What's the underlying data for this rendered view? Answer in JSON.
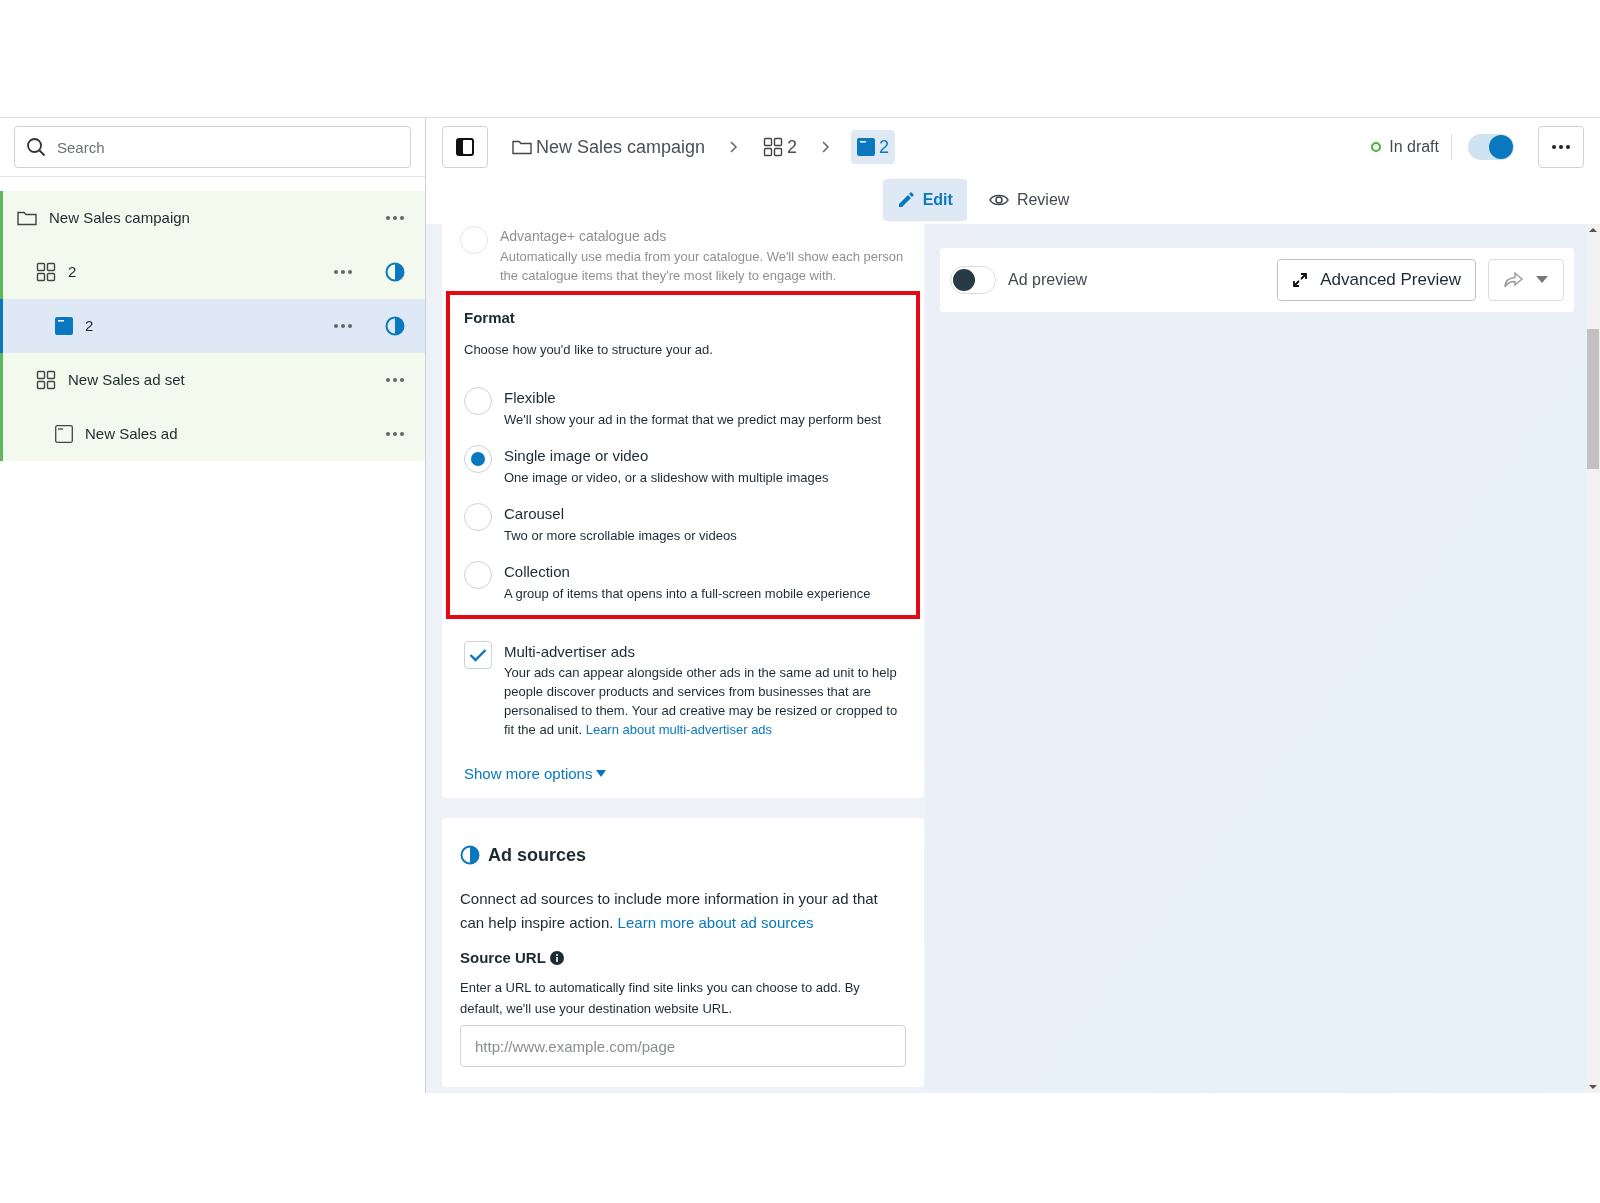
{
  "sidebar": {
    "search": {
      "placeholder": "Search"
    },
    "tree": [
      {
        "kind": "campaign",
        "label": "New Sales campaign",
        "selected": false,
        "badge": false,
        "children": [
          {
            "kind": "ad_set",
            "label": "2",
            "selected": false,
            "badge": true,
            "children": [
              {
                "kind": "ad",
                "label": "2",
                "selected": true,
                "badge": true
              }
            ]
          },
          {
            "kind": "ad_set",
            "label": "New Sales ad set",
            "selected": false,
            "badge": false,
            "children": [
              {
                "kind": "ad",
                "label": "New Sales ad",
                "selected": false,
                "badge": false
              }
            ]
          }
        ]
      }
    ]
  },
  "breadcrumb": [
    {
      "kind": "campaign",
      "label": "New Sales campaign",
      "selected": false
    },
    {
      "kind": "ad_set",
      "label": "2",
      "selected": false
    },
    {
      "kind": "ad",
      "label": "2",
      "selected": true
    }
  ],
  "status": {
    "label": "In draft",
    "color": "#42b72a"
  },
  "publish_toggle": {
    "on": true
  },
  "mode_tabs": [
    {
      "label": "Edit",
      "selected": true
    },
    {
      "label": "Review",
      "selected": false
    }
  ],
  "catalogue_option": {
    "selected": false,
    "title": "Advantage+ catalogue ads",
    "description": "Automatically use media from your catalogue. We'll show each person the catalogue items that they're most likely to engage with."
  },
  "format": {
    "title": "Format",
    "subtitle": "Choose how you'd like to structure your ad.",
    "highlighted": true,
    "options": [
      {
        "label": "Flexible",
        "description": "We'll show your ad in the format that we predict may perform best",
        "selected": false
      },
      {
        "label": "Single image or video",
        "description": "One image or video, or a slideshow with multiple images",
        "selected": true
      },
      {
        "label": "Carousel",
        "description": "Two or more scrollable images or videos",
        "selected": false
      },
      {
        "label": "Collection",
        "description": "A group of items that opens into a full-screen mobile experience",
        "selected": false
      }
    ]
  },
  "multi_advertiser": {
    "label": "Multi-advertiser ads",
    "checked": true,
    "description": "Your ads can appear alongside other ads in the same ad unit to help people discover products and services from businesses that are personalised to them. Your ad creative may be resized or cropped to fit the ad unit.",
    "link": "Learn about multi-advertiser ads"
  },
  "show_more": "Show more options",
  "ad_sources": {
    "title": "Ad sources",
    "description": "Connect ad sources to include more information in your ad that can help inspire action.",
    "link": "Learn more about ad sources",
    "field_label": "Source URL",
    "field_help": "Enter a URL to automatically find site links you can choose to add. By default, we'll use your destination website URL.",
    "placeholder": "http://www.example.com/page"
  },
  "preview": {
    "toggle_label": "Ad preview",
    "on": false,
    "advanced_button": "Advanced Preview"
  }
}
